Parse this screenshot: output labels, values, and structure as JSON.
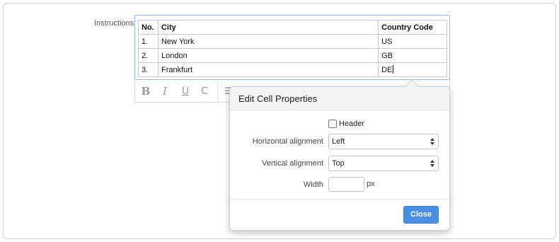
{
  "field": {
    "label": "Instructions"
  },
  "table": {
    "headers": [
      "No.",
      "City",
      "Country Code"
    ],
    "rows": [
      [
        "1.",
        "New York",
        "US"
      ],
      [
        "2.",
        "London",
        "GB"
      ],
      [
        "3.",
        "Frankfurt",
        "DE"
      ]
    ]
  },
  "toolbar": {
    "bold": "B",
    "italic": "I",
    "underline": "U",
    "strikethrough": "C",
    "icons": [
      "bold-icon",
      "italic-icon",
      "underline-icon",
      "strikethrough-icon",
      "table-icon"
    ]
  },
  "popup": {
    "title": "Edit Cell Properties",
    "header_checkbox": {
      "label": "Header",
      "checked": false
    },
    "horizontal_alignment": {
      "label": "Horizontal alignment",
      "value": "Left"
    },
    "vertical_alignment": {
      "label": "Vertical alignment",
      "value": "Top"
    },
    "width": {
      "label": "Width",
      "value": "",
      "unit": "px"
    },
    "close_label": "Close"
  },
  "colors": {
    "accent": "#4a90e2",
    "editor_focus_border": "#8fb8f0"
  }
}
